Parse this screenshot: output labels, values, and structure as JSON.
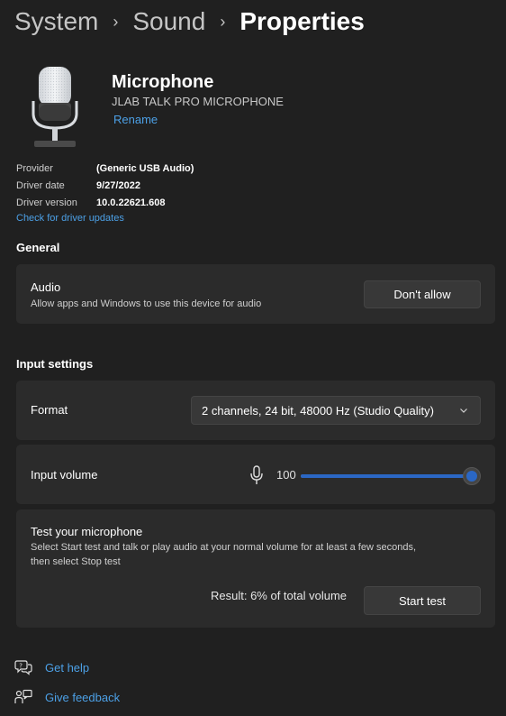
{
  "breadcrumb": {
    "items": [
      "System",
      "Sound"
    ],
    "current": "Properties",
    "separator": "›"
  },
  "device": {
    "name": "Microphone",
    "model": "JLAB TALK PRO MICROPHONE",
    "rename_label": "Rename"
  },
  "properties": [
    {
      "label": "Provider",
      "value": "(Generic USB Audio)"
    },
    {
      "label": "Driver date",
      "value": "9/27/2022"
    },
    {
      "label": "Driver version",
      "value": "10.0.22621.608"
    }
  ],
  "check_updates_label": "Check for driver updates",
  "general": {
    "title": "General",
    "audio": {
      "title": "Audio",
      "description": "Allow apps and Windows to use this device for audio",
      "button_label": "Don't allow"
    }
  },
  "input_settings": {
    "title": "Input settings",
    "format": {
      "label": "Format",
      "selected": "2 channels, 24 bit, 48000 Hz (Studio Quality)"
    },
    "volume": {
      "label": "Input volume",
      "value": 100,
      "value_text": "100"
    },
    "test": {
      "title": "Test your microphone",
      "description_line1": "Select Start test and talk or play audio at your normal volume for at least a few seconds,",
      "description_line2": "then select Stop test",
      "result": "Result: 6% of total volume",
      "button_label": "Start test"
    }
  },
  "footer": {
    "get_help": "Get help",
    "give_feedback": "Give feedback"
  },
  "colors": {
    "background": "#202020",
    "card": "#2b2b2b",
    "accent": "#2b67c4",
    "link": "#4ca0e6"
  }
}
